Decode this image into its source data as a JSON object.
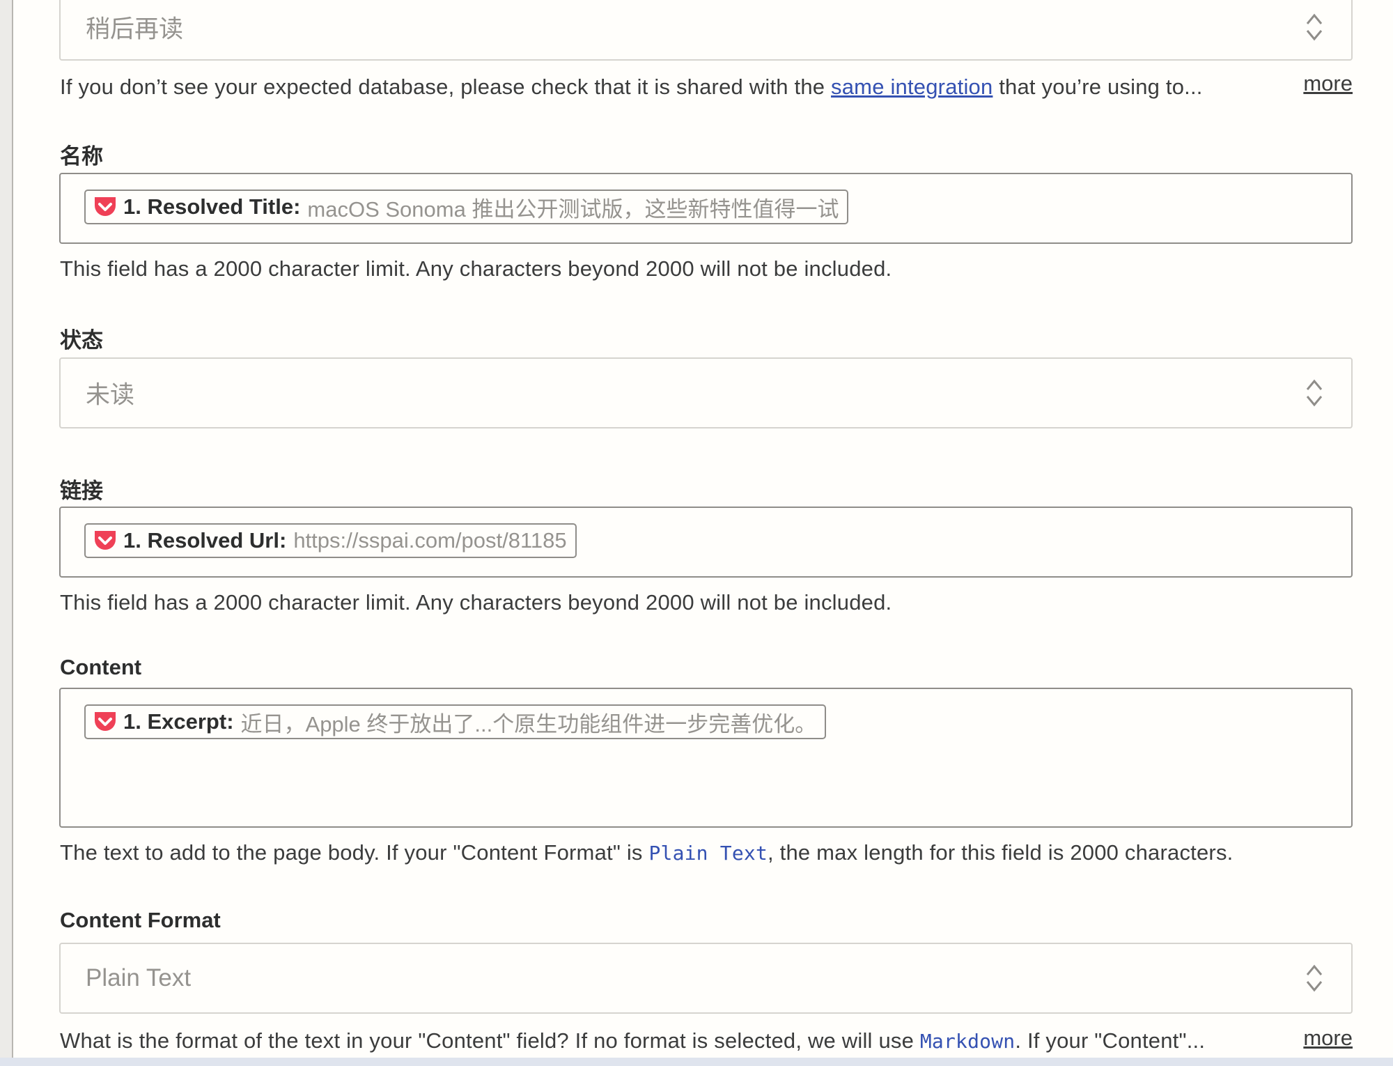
{
  "read_later_select": {
    "value": "稍后再读"
  },
  "database_help": {
    "prefix": "If you don’t see your expected database, please check that it is shared with the ",
    "link": "same integration",
    "suffix": " that you’re using to...",
    "more": "more"
  },
  "fields": {
    "name": {
      "label": "名称",
      "pill_key": "1. Resolved Title:",
      "pill_value": "macOS Sonoma 推出公开测试版，这些新特性值得一试",
      "help": "This field has a 2000 character limit. Any characters beyond 2000 will not be included."
    },
    "status": {
      "label": "状态",
      "value": "未读"
    },
    "link": {
      "label": "链接",
      "pill_key": "1. Resolved Url:",
      "pill_value": "https://sspai.com/post/81185",
      "help": "This field has a 2000 character limit. Any characters beyond 2000 will not be included."
    },
    "content": {
      "label": "Content",
      "pill_key": "1. Excerpt:",
      "pill_value": "近日，Apple 终于放出了...个原生功能组件进一步完善优化。",
      "help_prefix": "The text to add to the page body. If your \"Content Format\" is ",
      "help_code": "Plain Text",
      "help_suffix": ", the max length for this field is 2000 characters."
    },
    "content_format": {
      "label": "Content Format",
      "value": "Plain Text",
      "help_prefix": "What is the format of the text in your \"Content\" field? If no format is selected, we will use ",
      "help_code": "Markdown",
      "help_suffix": ". If your \"Content\"...",
      "more": "more"
    }
  },
  "icons": {
    "pill": "pocket-icon",
    "select": "chevron-up-down-icon"
  },
  "colors": {
    "pocket_red": "#ef4056",
    "link_blue": "#3451b2",
    "muted_text": "#95938f"
  }
}
